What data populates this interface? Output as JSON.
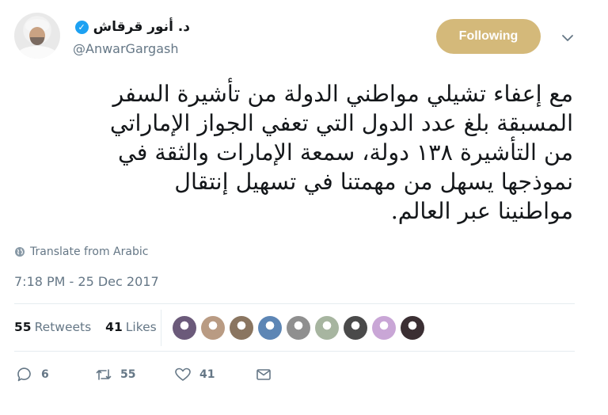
{
  "author": {
    "display_name": "د. أنور قرقاش",
    "handle": "@AnwarGargash",
    "verified": true
  },
  "follow_button": {
    "label": "Following",
    "color": "#d4b97a"
  },
  "tweet": {
    "lines": [
      "مع إعفاء تشيلي مواطني الدولة من تأشيرة السفر",
      "المسبقة بلغ عدد الدول التي تعفي الجواز الإماراتي",
      "من التأشيرة ١٣٨ دولة، سمعة الإمارات والثقة في",
      "نموذجها يسهل من مهمتنا في تسهيل إنتقال",
      "مواطنينا عبر العالم."
    ]
  },
  "translate_label": "Translate from Arabic",
  "timestamp": "7:18 PM - 25 Dec 2017",
  "stats": {
    "retweets_count": "55",
    "retweets_label": "Retweets",
    "likes_count": "41",
    "likes_label": "Likes"
  },
  "liker_avatars": [
    "#6b5a7a",
    "#b99b83",
    "#8a7560",
    "#5d86b5",
    "#8f8f8f",
    "#a7b5a0",
    "#4a4a4a",
    "#c9a6d6",
    "#3b2f33"
  ],
  "actions": {
    "reply_count": "6",
    "retweet_count": "55",
    "like_count": "41"
  }
}
